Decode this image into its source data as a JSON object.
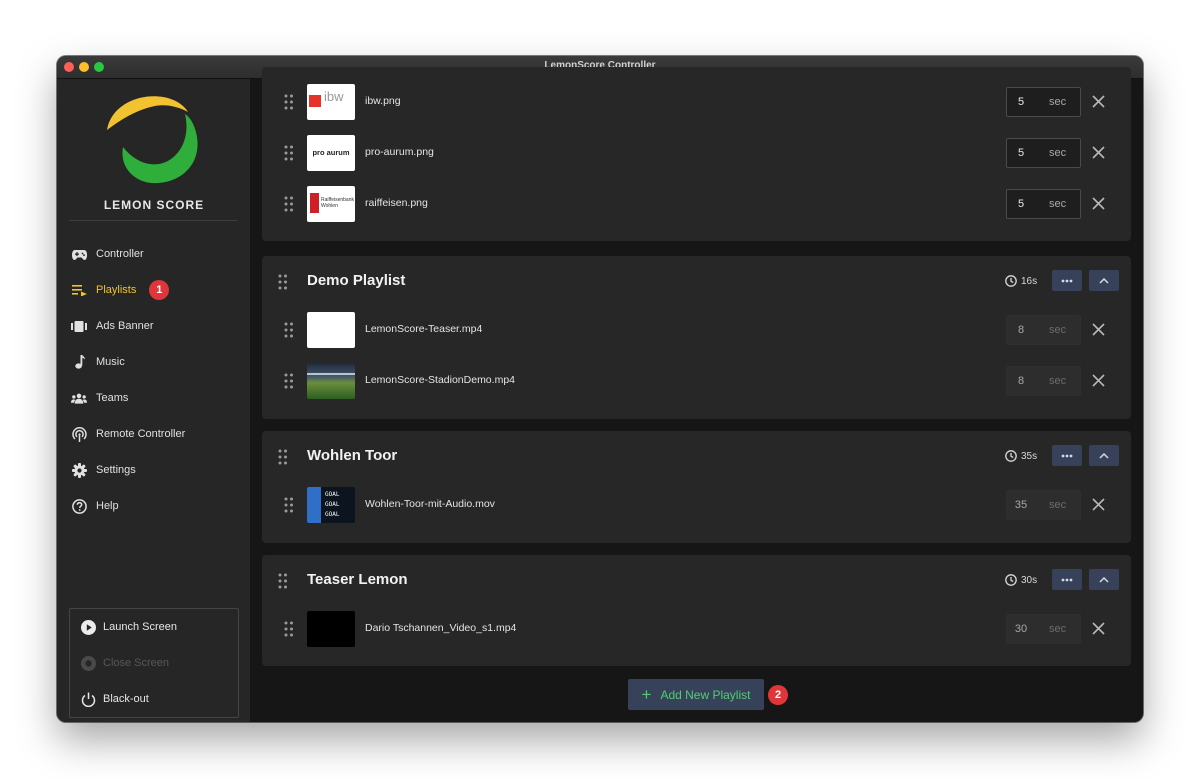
{
  "window": {
    "title": "LemonScore Controller"
  },
  "sidebar": {
    "logo_text": "LEMON SCORE",
    "nav": [
      {
        "label": "Controller",
        "icon": "gamepad-icon"
      },
      {
        "label": "Playlists",
        "icon": "playlist-icon",
        "active": true,
        "badge": "1"
      },
      {
        "label": "Ads Banner",
        "icon": "ads-banner-icon"
      },
      {
        "label": "Music",
        "icon": "music-note-icon"
      },
      {
        "label": "Teams",
        "icon": "teams-icon"
      },
      {
        "label": "Remote Controller",
        "icon": "remote-antenna-icon"
      },
      {
        "label": "Settings",
        "icon": "gear-icon"
      },
      {
        "label": "Help",
        "icon": "help-icon"
      }
    ],
    "screen_controls": {
      "launch": "Launch Screen",
      "close": "Close Screen",
      "blackout": "Black-out"
    }
  },
  "playlists": [
    {
      "items": [
        {
          "file": "ibw.png",
          "duration": "5",
          "unit": "sec",
          "thumb_text": "ibw"
        },
        {
          "file": "pro-aurum.png",
          "duration": "5",
          "unit": "sec",
          "thumb_text": "pro aurum"
        },
        {
          "file": "raiffeisen.png",
          "duration": "5",
          "unit": "sec",
          "thumb_text": "Raiffeisenbank Wohlen"
        }
      ]
    },
    {
      "name": "Demo Playlist",
      "total": "16s",
      "items": [
        {
          "file": "LemonScore-Teaser.mp4",
          "duration": "8",
          "unit": "sec"
        },
        {
          "file": "LemonScore-StadionDemo.mp4",
          "duration": "8",
          "unit": "sec"
        }
      ]
    },
    {
      "name": "Wohlen Toor",
      "total": "35s",
      "items": [
        {
          "file": "Wohlen-Toor-mit-Audio.mov",
          "duration": "35",
          "unit": "sec",
          "thumb_text": "GOAL"
        }
      ]
    },
    {
      "name": "Teaser Lemon",
      "total": "30s",
      "items": [
        {
          "file": "Dario Tschannen_Video_s1.mp4",
          "duration": "30",
          "unit": "sec"
        }
      ]
    }
  ],
  "add_playlist": {
    "label": "Add New Playlist",
    "badge": "2"
  },
  "colors": {
    "accent_yellow": "#f2c230",
    "accent_green": "#4fcf71",
    "badge_red": "#e0363a",
    "button_blue": "#37425a"
  }
}
